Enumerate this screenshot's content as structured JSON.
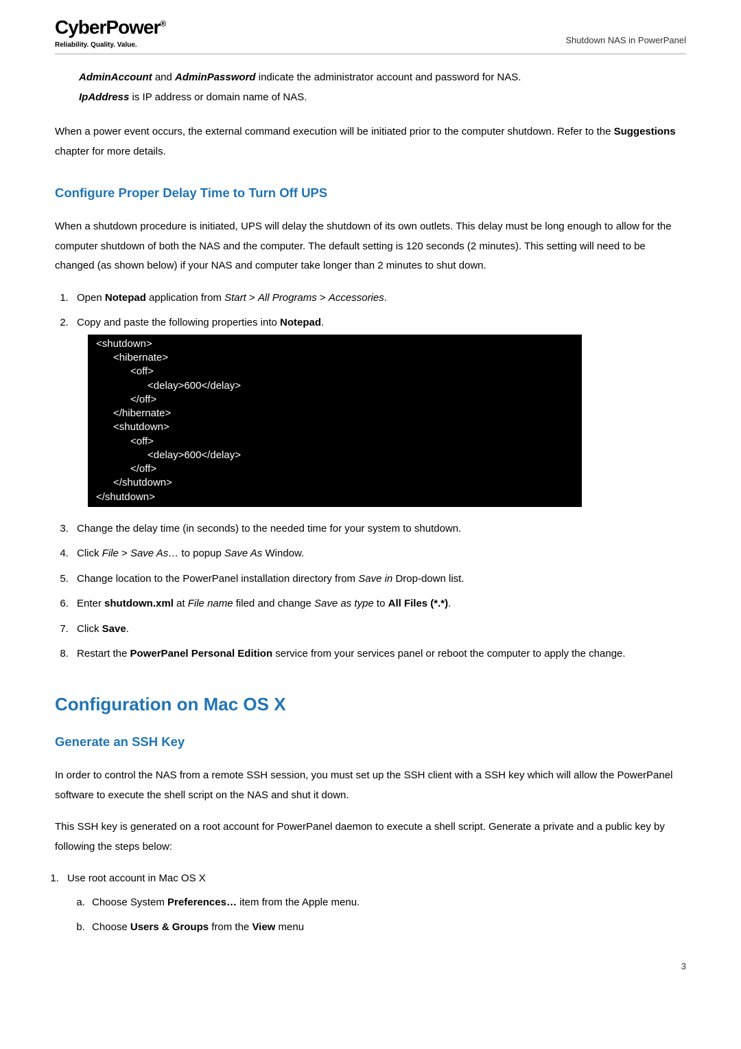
{
  "header": {
    "logo_main": "CyberPower",
    "logo_reg": "®",
    "tagline": "Reliability. Quality. Value.",
    "right_text": "Shutdown NAS in PowerPanel"
  },
  "intro": {
    "line1_a": "AdminAccount",
    "line1_b": " and ",
    "line1_c": "AdminPassword",
    "line1_d": " indicate the administrator account and password for NAS.",
    "line2_a": "IpAddress",
    "line2_b": " is IP address or domain name of NAS."
  },
  "para1_a": "When a power event occurs, the external command execution will be initiated prior to the computer shutdown. Refer to the ",
  "para1_b": "Suggestions",
  "para1_c": " chapter for more details.",
  "section1_title": "Configure Proper Delay Time to Turn Off UPS",
  "section1_para": "When a shutdown procedure is initiated, UPS will delay the shutdown of its own outlets. This delay must be long enough to allow for the computer shutdown of both the NAS and the computer. The default setting is 120 seconds (2 minutes). This setting will need to be changed (as shown below) if your NAS and computer take longer than 2 minutes to shut down.",
  "list1": {
    "i1_a": "Open ",
    "i1_b": "Notepad",
    "i1_c": " application from ",
    "i1_d": "Start",
    "i1_e": " > ",
    "i1_f": "All Programs",
    "i1_g": " > ",
    "i1_h": "Accessories",
    "i1_i": ".",
    "i2_a": "Copy and paste the following properties into ",
    "i2_b": "Notepad",
    "i2_c": "."
  },
  "codeblock": "<shutdown>\n      <hibernate>\n            <off>\n                  <delay>600</delay>\n            </off>\n      </hibernate>\n      <shutdown>\n            <off>\n                  <delay>600</delay>\n            </off>\n      </shutdown>\n</shutdown>",
  "list2": {
    "i3": "Change the delay time (in seconds) to the needed time for your system to shutdown.",
    "i4_a": "Click ",
    "i4_b": "File",
    "i4_c": " > ",
    "i4_d": "Save As…",
    "i4_e": " to popup ",
    "i4_f": "Save As",
    "i4_g": " Window.",
    "i5_a": "Change location to the PowerPanel installation directory from ",
    "i5_b": "Save in",
    "i5_c": " Drop-down list.",
    "i6_a": "Enter ",
    "i6_b": "shutdown.xml",
    "i6_c": " at ",
    "i6_d": "File name",
    "i6_e": " filed and change ",
    "i6_f": "Save as type",
    "i6_g": " to ",
    "i6_h": "All Files (*.*)",
    "i6_i": ".",
    "i7_a": "Click ",
    "i7_b": "Save",
    "i7_c": ".",
    "i8_a": "Restart the ",
    "i8_b": "PowerPanel Personal Edition",
    "i8_c": " service from your services panel or reboot the computer to apply the change."
  },
  "section2_title": "Configuration on Mac OS X",
  "section2_sub": "Generate an SSH Key",
  "section2_para1": "In order to control the NAS from a remote SSH session, you must set up the SSH client with a SSH key which will allow the PowerPanel software to execute the shell script on the NAS and shut it down.",
  "section2_para2": "This SSH key is generated on a root account for PowerPanel daemon to execute a shell script. Generate a private and a public key by following the steps below:",
  "list3": {
    "i1": "Use root account in Mac OS X",
    "sa_a": "Choose System ",
    "sa_b": "Preferences…",
    "sa_c": " item from the Apple menu.",
    "sb_a": "Choose ",
    "sb_b": "Users & Groups",
    "sb_c": " from the ",
    "sb_d": "View",
    "sb_e": " menu"
  },
  "page_number": "3"
}
